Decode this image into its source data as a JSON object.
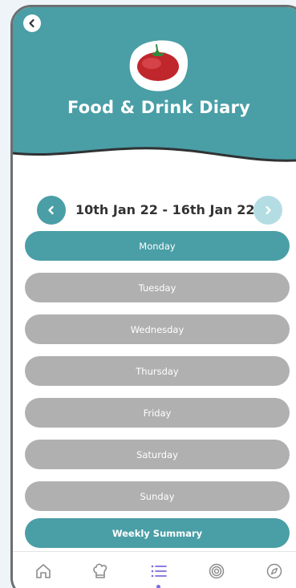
{
  "header": {
    "title": "Food & Drink Diary",
    "back_icon": "chevron-left-icon",
    "logo": "tomato-logo",
    "color": "#4a9ea6"
  },
  "week_nav": {
    "label": "10th Jan 22 - 16th Jan 22",
    "prev_icon": "chevron-left-icon",
    "next_icon": "chevron-right-icon"
  },
  "days": [
    {
      "label": "Monday",
      "state": "active"
    },
    {
      "label": "Tuesday",
      "state": "inactive"
    },
    {
      "label": "Wednesday",
      "state": "inactive"
    },
    {
      "label": "Thursday",
      "state": "inactive"
    },
    {
      "label": "Friday",
      "state": "inactive"
    },
    {
      "label": "Saturday",
      "state": "inactive"
    },
    {
      "label": "Sunday",
      "state": "inactive"
    }
  ],
  "summary_button": {
    "label": "Weekly Summary"
  },
  "tabbar": {
    "tabs": [
      {
        "icon": "home-icon"
      },
      {
        "icon": "chef-hat-icon"
      },
      {
        "icon": "list-icon",
        "selected": true
      },
      {
        "icon": "target-icon"
      },
      {
        "icon": "compass-icon"
      }
    ],
    "selected_color": "#7b6de0"
  },
  "colors": {
    "accent": "#4a9ea6",
    "inactive": "#b0b0b0",
    "next_disabled": "#b3dde2"
  }
}
